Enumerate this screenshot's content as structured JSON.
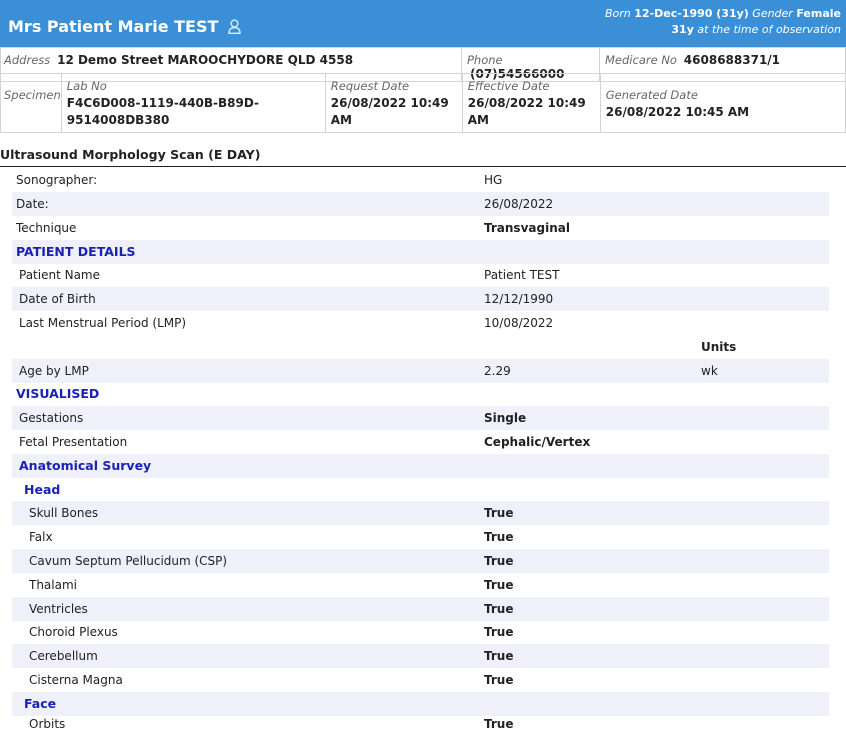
{
  "header": {
    "patient_name": "Mrs Patient Marie TEST",
    "born_label": "Born",
    "born_value": "12-Dec-1990 (31y)",
    "gender_label": "Gender",
    "gender_value": "Female",
    "age_value": "31y",
    "age_note": "at the time of observation"
  },
  "info": {
    "address_label": "Address",
    "address_value": "12 Demo Street MAROOCHYDORE QLD 4558",
    "phone_label": "Phone",
    "phone_value": "(07)54566000",
    "medicare_label": "Medicare No",
    "medicare_value": "4608688371/1",
    "specimen_label": "Specimen",
    "lab_label": "Lab No",
    "lab_value_1": "F4C6D008-1119-440B-B89D-",
    "lab_value_2": "9514008DB380",
    "request_label": "Request Date",
    "request_value_1": "26/08/2022 10:49",
    "request_value_2": "AM",
    "effective_label": "Effective Date",
    "effective_value_1": "26/08/2022 10:49",
    "effective_value_2": "AM",
    "generated_label": "Generated Date",
    "generated_value": "26/08/2022 10:45 AM"
  },
  "report": {
    "title": "Ultrasound Morphology Scan (E DAY)",
    "rows": [
      {
        "label": "Sonographer:",
        "value": "HG"
      },
      {
        "label": "Date:",
        "value": "26/08/2022"
      },
      {
        "label": "Technique",
        "value": "Transvaginal"
      },
      {
        "label": "PATIENT DETAILS"
      },
      {
        "label": "Patient Name",
        "value": "Patient TEST"
      },
      {
        "label": "Date of Birth",
        "value": "12/12/1990"
      },
      {
        "label": "Last Menstrual Period (LMP)",
        "value": "10/08/2022"
      },
      {
        "units": "Units"
      },
      {
        "label": "Age by LMP",
        "value": "2.29",
        "units": "wk"
      },
      {
        "label": "VISUALISED"
      },
      {
        "label": "Gestations",
        "value": "Single"
      },
      {
        "label": "Fetal Presentation",
        "value": "Cephalic/Vertex"
      },
      {
        "label": "Anatomical Survey"
      },
      {
        "label": "Head"
      },
      {
        "label": "Skull Bones",
        "value": "True"
      },
      {
        "label": "Falx",
        "value": "True"
      },
      {
        "label": "Cavum Septum Pellucidum (CSP)",
        "value": "True"
      },
      {
        "label": "Thalami",
        "value": "True"
      },
      {
        "label": "Ventricles",
        "value": "True"
      },
      {
        "label": "Choroid Plexus",
        "value": "True"
      },
      {
        "label": "Cerebellum",
        "value": "True"
      },
      {
        "label": "Cisterna Magna",
        "value": "True"
      },
      {
        "label": "Face"
      },
      {
        "label": "Orbits",
        "value": "True"
      }
    ]
  }
}
